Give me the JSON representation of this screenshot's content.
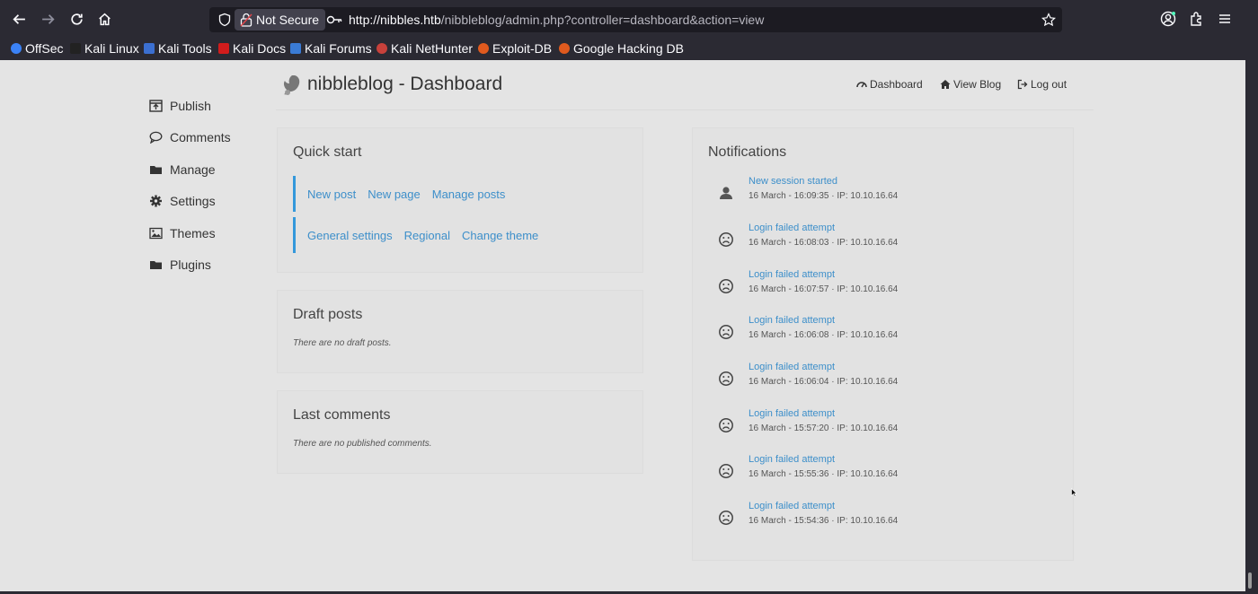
{
  "browser": {
    "security_label": "Not Secure",
    "url_host": "http://nibbles.htb",
    "url_path": "/nibbleblog/admin.php?controller=dashboard&action=view",
    "bookmarks": [
      {
        "label": "OffSec",
        "color": "#3b82f6"
      },
      {
        "label": "Kali Linux",
        "color": "#222222"
      },
      {
        "label": "Kali Tools",
        "color": "#3b6fd1"
      },
      {
        "label": "Kali Docs",
        "color": "#d21c1c"
      },
      {
        "label": "Kali Forums",
        "color": "#3a7bd5"
      },
      {
        "label": "Kali NetHunter",
        "color": "#c8413b"
      },
      {
        "label": "Exploit-DB",
        "color": "#e05a1e"
      },
      {
        "label": "Google Hacking DB",
        "color": "#e05a1e"
      }
    ]
  },
  "sidebar": {
    "items": [
      {
        "label": "Publish",
        "icon": "publish-icon"
      },
      {
        "label": "Comments",
        "icon": "comment-icon"
      },
      {
        "label": "Manage",
        "icon": "folder-icon"
      },
      {
        "label": "Settings",
        "icon": "gear-icon"
      },
      {
        "label": "Themes",
        "icon": "image-icon"
      },
      {
        "label": "Plugins",
        "icon": "folder-icon"
      }
    ]
  },
  "header": {
    "title": "nibbleblog - Dashboard",
    "links": [
      {
        "label": "Dashboard",
        "icon": "gauge-icon"
      },
      {
        "label": "View Blog",
        "icon": "home-icon"
      },
      {
        "label": "Log out",
        "icon": "logout-icon"
      }
    ]
  },
  "quick_start": {
    "title": "Quick start",
    "row1": [
      "New post",
      "New page",
      "Manage posts"
    ],
    "row2": [
      "General settings",
      "Regional",
      "Change theme"
    ]
  },
  "draft_posts": {
    "title": "Draft posts",
    "message": "There are no draft posts."
  },
  "last_comments": {
    "title": "Last comments",
    "message": "There are no published comments."
  },
  "notifications": {
    "title": "Notifications",
    "items": [
      {
        "title": "New session started",
        "meta": "16 March - 16:09:35 · IP: 10.10.16.64",
        "icon": "user-icon"
      },
      {
        "title": "Login failed attempt",
        "meta": "16 March - 16:08:03 · IP: 10.10.16.64",
        "icon": "frown-icon"
      },
      {
        "title": "Login failed attempt",
        "meta": "16 March - 16:07:57 · IP: 10.10.16.64",
        "icon": "frown-icon"
      },
      {
        "title": "Login failed attempt",
        "meta": "16 March - 16:06:08 · IP: 10.10.16.64",
        "icon": "frown-icon"
      },
      {
        "title": "Login failed attempt",
        "meta": "16 March - 16:06:04 · IP: 10.10.16.64",
        "icon": "frown-icon"
      },
      {
        "title": "Login failed attempt",
        "meta": "16 March - 15:57:20 · IP: 10.10.16.64",
        "icon": "frown-icon"
      },
      {
        "title": "Login failed attempt",
        "meta": "16 March - 15:55:36 · IP: 10.10.16.64",
        "icon": "frown-icon"
      },
      {
        "title": "Login failed attempt",
        "meta": "16 March - 15:54:36 · IP: 10.10.16.64",
        "icon": "frown-icon"
      }
    ]
  }
}
